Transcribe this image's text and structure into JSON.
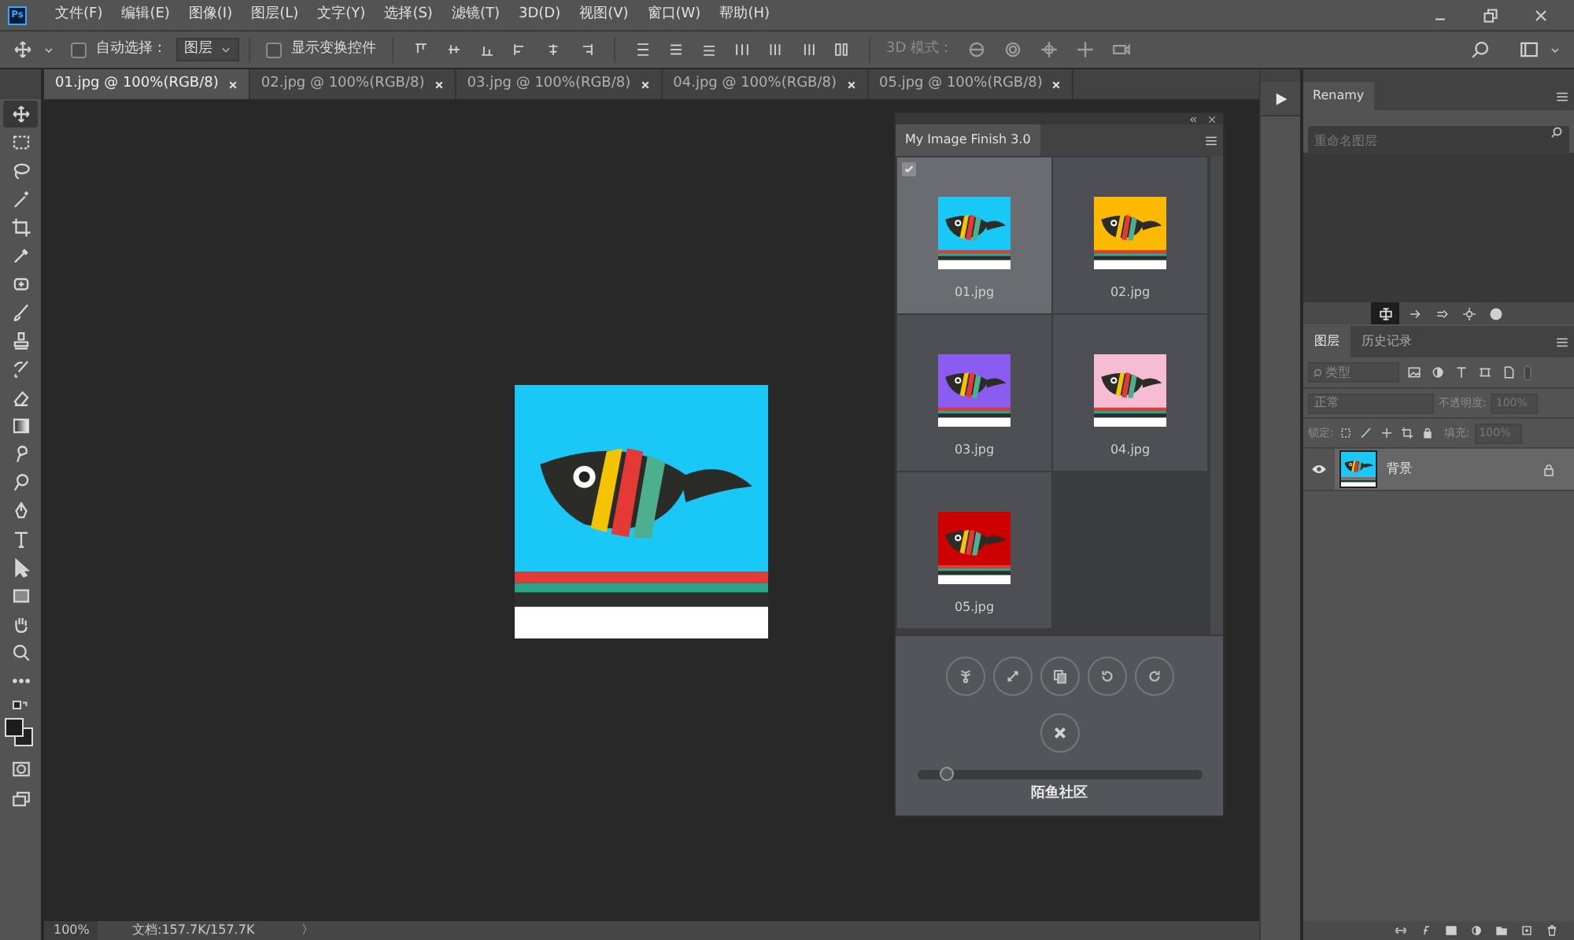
{
  "app_logo": "Ps",
  "menu": [
    "文件(F)",
    "编辑(E)",
    "图像(I)",
    "图层(L)",
    "文字(Y)",
    "选择(S)",
    "滤镜(T)",
    "3D(D)",
    "视图(V)",
    "窗口(W)",
    "帮助(H)"
  ],
  "options": {
    "auto_select": {
      "label": "自动选择：",
      "checked": false
    },
    "target": "图层",
    "show_transform": {
      "label": "显示变换控件",
      "checked": false
    },
    "mode_3d": "3D 模式："
  },
  "tabs": [
    {
      "label": "01.jpg @ 100%(RGB/8)",
      "selected": true
    },
    {
      "label": "02.jpg @ 100%(RGB/8)",
      "selected": false
    },
    {
      "label": "03.jpg @ 100%(RGB/8)",
      "selected": false
    },
    {
      "label": "04.jpg @ 100%(RGB/8)",
      "selected": false
    },
    {
      "label": "05.jpg @ 100%(RGB/8)",
      "selected": false
    }
  ],
  "tools": [
    {
      "kind": "move",
      "selected": true
    },
    {
      "kind": "marquee",
      "selected": false
    },
    {
      "kind": "lasso",
      "selected": false
    },
    {
      "kind": "wand",
      "selected": false
    },
    {
      "kind": "crop",
      "selected": false
    },
    {
      "kind": "eyedropper",
      "selected": false
    },
    {
      "kind": "healing",
      "selected": false
    },
    {
      "kind": "brush",
      "selected": false
    },
    {
      "kind": "stamp",
      "selected": false
    },
    {
      "kind": "history",
      "selected": false
    },
    {
      "kind": "eraser",
      "selected": false
    },
    {
      "kind": "gradient",
      "selected": false
    },
    {
      "kind": "smudge",
      "selected": false
    },
    {
      "kind": "dodge",
      "selected": false
    },
    {
      "kind": "pen",
      "selected": false
    },
    {
      "kind": "type",
      "selected": false
    },
    {
      "kind": "select",
      "selected": false
    },
    {
      "kind": "rect",
      "selected": false
    },
    {
      "kind": "hand",
      "selected": false
    },
    {
      "kind": "zoom",
      "selected": false
    },
    {
      "kind": "more",
      "selected": false
    }
  ],
  "document": {
    "color": "#1ac8f8"
  },
  "plugin_panel": {
    "title": "My Image Finish 3.0",
    "thumbnails": [
      {
        "label": "01.jpg",
        "color": "#1ac8f8",
        "selected": true
      },
      {
        "label": "02.jpg",
        "color": "#fcb900",
        "selected": false
      },
      {
        "label": "03.jpg",
        "color": "#8a5cf0",
        "selected": false
      },
      {
        "label": "04.jpg",
        "color": "#f6bcd4",
        "selected": false
      },
      {
        "label": "05.jpg",
        "color": "#cc0000",
        "selected": false
      }
    ],
    "size_slider": {
      "level": 0.1
    },
    "footer": "陌鱼社区"
  },
  "renamy": {
    "tab": "Renamy",
    "search": {
      "placeholder": "重命名图层"
    }
  },
  "layers_panel": {
    "tabs": [
      {
        "label": "图层",
        "selected": true
      },
      {
        "label": "历史记录",
        "selected": false
      }
    ],
    "filter": "类型",
    "blend_mode": "正常",
    "opacity_label": "不透明度:",
    "opacity": "100%",
    "lock_label": "锁定:",
    "fill_label": "填充:",
    "fill": "100%",
    "layers": [
      {
        "name": "背景",
        "visible": true,
        "locked": true,
        "selected": true
      }
    ]
  },
  "status_bar": {
    "zoom": "100%",
    "doc_size": "文档:157.7K/157.7K",
    "arrow": "〉"
  }
}
